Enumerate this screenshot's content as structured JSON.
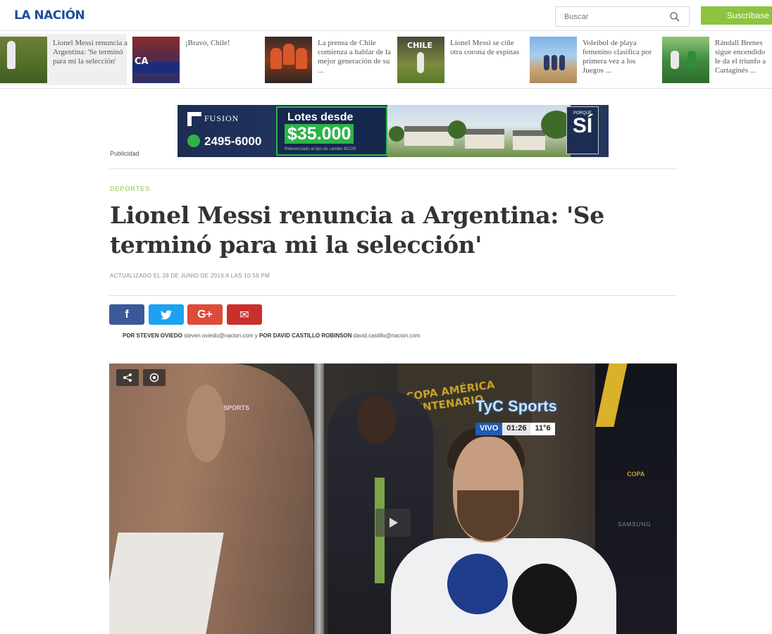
{
  "header": {
    "logo": "LA NACIÓN",
    "search_placeholder": "Buscar",
    "subscribe_label": "Suscríbase"
  },
  "headlines": [
    {
      "caption": "Lionel Messi renuncia a Argentina: 'Se terminó para mi la selección'"
    },
    {
      "caption": "¡Bravo, Chile!",
      "thumb_text": "CA"
    },
    {
      "caption": "La prensa de Chile comienza a hablar de la mejor generación de su ..."
    },
    {
      "caption": "Lionel Messi se ciñe otra corona de espinas",
      "thumb_text": "CHILE"
    },
    {
      "caption": "Voleibol de playa femenino clasifica por primera vez a los Juegos ..."
    },
    {
      "caption": "Rándall Brenes sigue encendido le da el triunfo a Cartaginés ..."
    }
  ],
  "ad": {
    "brand": "FUSION",
    "phone": "2495-6000",
    "offer_line1": "Lotes desde",
    "offer_line2": "$35.000",
    "offer_note": "Referenciado al tipo de cambio BCCR",
    "tag_small": "PORQUE",
    "tag_big": "SÍ",
    "label": "Publicidad"
  },
  "article": {
    "section": "DEPORTES",
    "title": "Lionel Messi renuncia a Argentina: 'Se terminó para mi la selección'",
    "updated": "ACTUALIZADO EL 28 DE JUNIO DE 2016 A LAS 10:59 PM",
    "byline": {
      "prefix1": "POR STEVEN OVIEDO",
      "email1": "steven.oviedo@nacion.com",
      "joiner": "y",
      "prefix2": "POR DAVID CASTILLO ROBINSON",
      "email2": "david.castillo@nacion.com"
    }
  },
  "share": {
    "facebook": "f",
    "twitter": "t",
    "googleplus": "G+",
    "email": "✉"
  },
  "video": {
    "channel": "TyC Sports",
    "live_label": "VIVO",
    "clock": "01:26",
    "temp": "11°6",
    "sign_text": "COPA AMÉRICA CENTENARIO",
    "side_text": "COPA",
    "sponsor_text": "SAMSUNG",
    "mic_text": "SPORTS"
  },
  "colors": {
    "accent_green": "#8cc43f",
    "logo_blue": "#1f4e9c",
    "facebook": "#3b5998",
    "twitter": "#1da1f2",
    "googleplus": "#dd4b39",
    "email": "#c9302c"
  }
}
